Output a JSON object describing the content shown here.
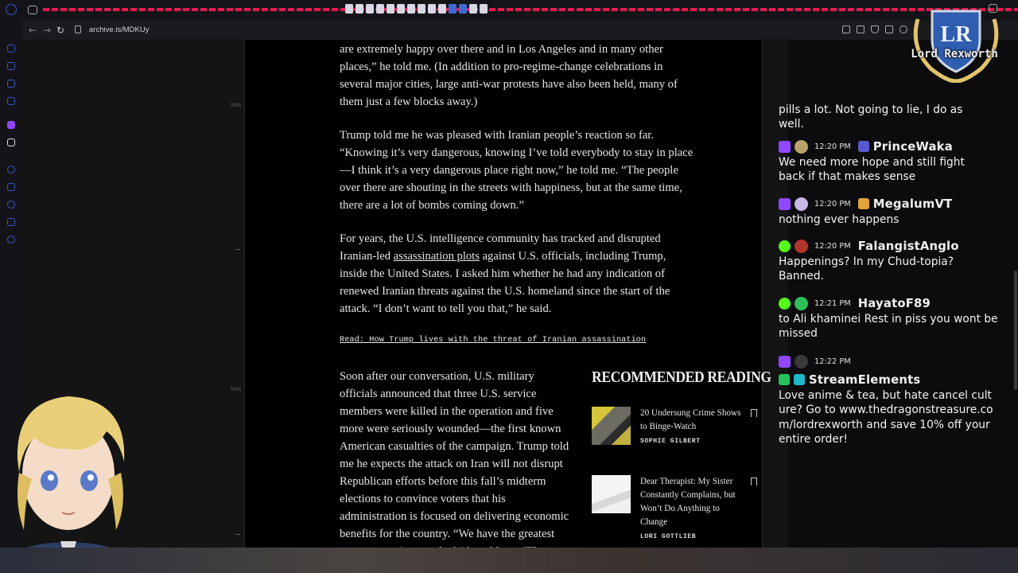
{
  "browser": {
    "url": "archive.is/MDKUy",
    "nav": {
      "back": "←",
      "forward": "→",
      "reload": "↻"
    }
  },
  "page": {
    "zoom_markers": [
      "50%",
      "50%"
    ],
    "paragraphs": [
      {
        "text": "are extremely happy over there and in Los Angeles and in many other places,” he told me. (In addition to pro-regime-change celebrations in several major cities, large anti-war protests have also been held, many of them just a few blocks away.)"
      },
      {
        "text": "Trump told me he was pleased with Iranian people’s reaction so far. “Knowing it’s very dangerous, knowing I’ve told everybody to stay in place—I think it’s a very dangerous place right now,” he told me. “The people over there are shouting in the streets with happiness, but at the same time, there are a lot of bombs coming down.”"
      },
      {
        "before": "For years, the U.S. intelligence community has tracked and disrupted Iranian-led ",
        "link": "assassination plots",
        "after": " against U.S. officials, including Trump, inside the United States. I asked him whether he had any indication of renewed Iranian threats against the U.S. homeland since the start of the attack. “I don’t want to tell you that,” he said."
      }
    ],
    "read_link": "Read: How Trump lives with the threat of Iranian assassination",
    "paragraph_after": "Soon after our conversation, U.S. military officials announced that three U.S. service members were killed in the operation and five more were seriously wounded—the first known American casualties of the campaign. Trump told me he expects the attack on Iran will not disrupt Republican efforts before this fall’s midterm elections to convince voters that his administration is focused on delivering economic benefits for the country. “We have the greatest economy we’ve ever had,” he told me. “The",
    "recommended": {
      "heading": "RECOMMENDED READING",
      "items": [
        {
          "title": "20 Undersung Crime Shows to Binge-Watch",
          "author": "SOPHIE GILBERT"
        },
        {
          "title": "Dear Therapist: My Sister Constantly Complains, but Won’t Do Anything to Change",
          "author": "LORI GOTTLIEB"
        }
      ]
    }
  },
  "overlay": {
    "logo_text": "Lord Rexworth"
  },
  "chat": {
    "partial_message": "pills a lot. Not going to lie, I do as well.",
    "messages": [
      {
        "platform": "twitch",
        "time": "12:20 PM",
        "user": "PrinceWaka",
        "text": "We need more hope and still fight back if that makes sense",
        "pfp_color": "#b9a36a",
        "badge_color": "#5a5ad0"
      },
      {
        "platform": "twitch",
        "time": "12:20 PM",
        "user": "MegalumVT",
        "text": "nothing ever happens",
        "pfp_color": "#c9b7e8",
        "badge_color": "#e2a33a"
      },
      {
        "platform": "kick",
        "time": "12:20 PM",
        "user": "FalangistAnglo",
        "text": "Happenings? In my Chud-topia? Banned.",
        "pfp_color": "#b4342c",
        "badge_color": ""
      },
      {
        "platform": "kick",
        "time": "12:21 PM",
        "user": "HayatoF89",
        "text": "to Ali khaminei Rest in piss you wont be missed",
        "pfp_color": "#2fbf5a",
        "badge_color": ""
      },
      {
        "platform": "twitch",
        "time": "12:22 PM",
        "user": "StreamElements",
        "text": "Love anime & tea, but hate cancel culture? Go to www.thedragonstreasure.com/lordrexworth and save 10% off your entire order!",
        "pfp_color": "#3a3a3a",
        "badge_color": "#27c25b"
      }
    ]
  },
  "colors": {
    "tab_accent": "#e8194f",
    "twitch": "#9147ff",
    "kick": "#53fc18"
  }
}
